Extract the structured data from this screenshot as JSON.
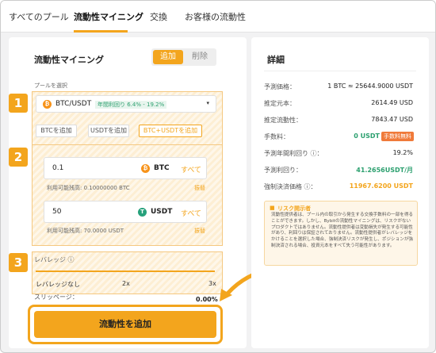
{
  "nav": {
    "tabs": [
      "すべてのプール",
      "流動性マイニング",
      "交換",
      "お客様の流動性"
    ]
  },
  "left": {
    "title": "流動性マイニング",
    "seg_add": "追加",
    "seg_remove": "削除",
    "pool_label": "プールを選択",
    "pool_pair": "BTC/USDT",
    "pool_apr": "年間利回り 6.4% - 19.2%",
    "chips": [
      "BTCを追加",
      "USDTを追加",
      "BTC+USDTを追加"
    ],
    "btc_amount": "0.1",
    "btc_symbol": "BTC",
    "btc_max": "すべて",
    "btc_available": "利用可能残高: 0.10000000 BTC",
    "btc_transfer": "振替",
    "usdt_amount": "50",
    "usdt_symbol": "USDT",
    "usdt_max": "すべて",
    "usdt_available": "利用可能残高: 70.0000 USDT",
    "usdt_transfer": "振替",
    "leverage_label": "レバレッジ ⓘ",
    "leverage_none": "レバレッジなし",
    "leverage_2x": "2x",
    "leverage_3x": "3x",
    "slippage_label": "スリッページ：",
    "slippage_value": "0.00%",
    "submit": "流動性を追加",
    "steps": [
      "1",
      "2",
      "3"
    ]
  },
  "right": {
    "title": "詳細",
    "rows": [
      {
        "label": "予測価格：",
        "value": "1 BTC ≈ 25644.9000 USDT"
      },
      {
        "label": "推定元本：",
        "value": "2614.49 USD"
      },
      {
        "label": "推定流動性：",
        "value": "7843.47 USD"
      },
      {
        "label": "手数料：",
        "value": "0 USDT",
        "badge": "手数料無料"
      },
      {
        "label": "予測年間利回り ⓘ：",
        "value": "19.2%"
      },
      {
        "label": "予測利回り：",
        "value": "41.2656USDT/月"
      },
      {
        "label": "強制決済価格 ⓘ：",
        "value": "11967.6200 USDT"
      }
    ],
    "risk_title": "リスク開示者",
    "risk_text": "流動性提供者は、プール内の取引から発生する交換手数料の一部を得ることができます。しかし、Bybitの流動性マイニングは、リスクがないプロダクトではありません。流動性提供者は変動損失が発生する可能性があり、利回りは保証されておりません。流動性提供者がレバレッジをかけることを選択した場合、強制決済リスクが発生し、ポジションが強制決済される場合、投資元本をすべて失う可能性があります。"
  },
  "colors": {
    "accent": "#f3a51d",
    "green": "#2ca06f",
    "btc": "#f7931a",
    "usdt": "#26a17b"
  }
}
